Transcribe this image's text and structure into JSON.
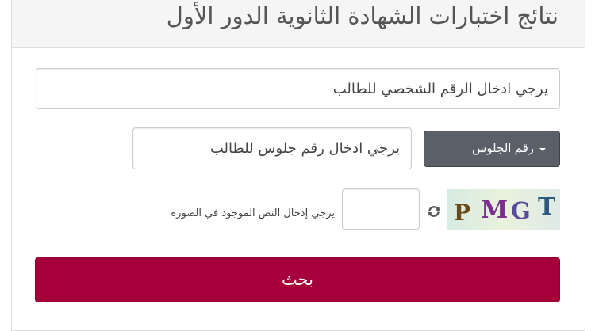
{
  "header": {
    "title": "نتائج اختبارات الشهادة الثانوية الدور الأول"
  },
  "form": {
    "national_id": {
      "placeholder": "يرجي ادخال الرقم الشخصي للطالب",
      "value": ""
    },
    "search_type": {
      "selected": "رقم الجلوس",
      "icon": "caret-down-icon"
    },
    "seat_number": {
      "placeholder": "يرجي ادخال رقم جلوس للطالب",
      "value": ""
    },
    "captcha": {
      "image_text": [
        "P",
        "M",
        "G",
        "T"
      ],
      "image_colors": [
        "#6b4a1a",
        "#7a2f8f",
        "#5a4a9a",
        "#2d5a7a"
      ],
      "refresh_icon": "refresh-icon",
      "input_value": "",
      "instruction": "يرجي إدخال النص الموجود في الصورة"
    },
    "search_button_label": "بحث"
  },
  "colors": {
    "primary_button": "#a5003a",
    "dropdown_button": "#5b6068",
    "header_background": "#f5f5f5"
  }
}
